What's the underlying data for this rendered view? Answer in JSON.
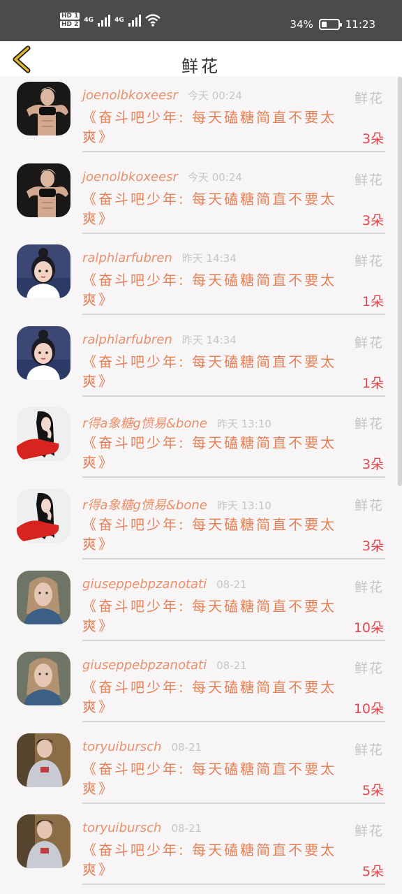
{
  "status_bar": {
    "hd1": "HD 1",
    "hd2": "HD 2",
    "net1": "4G",
    "net2": "4G",
    "battery_percent": 34,
    "battery_text": "34%",
    "time": "11:23"
  },
  "header": {
    "title": "鲜花",
    "back_icon": "chevron-left-icon",
    "accent_color": "#e1b52d"
  },
  "colors": {
    "username": "#e9906a",
    "message": "#e68157",
    "count": "#e0474d",
    "muted": "#c6c6c6"
  },
  "items": [
    {
      "username": "joenolbkoxeesr",
      "time": "今天 00:24",
      "tag": "鲜花",
      "message": "《奋斗吧少年: 每天磕糖简直不要太爽》",
      "count": "3朵",
      "avatar": "fitness-woman-avatar"
    },
    {
      "username": "joenolbkoxeesr",
      "time": "今天 00:24",
      "tag": "鲜花",
      "message": "《奋斗吧少年: 每天磕糖简直不要太爽》",
      "count": "3朵",
      "avatar": "fitness-woman-avatar"
    },
    {
      "username": "ralphlarfubren",
      "time": "昨天 14:34",
      "tag": "鲜花",
      "message": "《奋斗吧少年: 每天磕糖简直不要太爽》",
      "count": "1朵",
      "avatar": "cartoon-girl-avatar"
    },
    {
      "username": "ralphlarfubren",
      "time": "昨天 14:34",
      "tag": "鲜花",
      "message": "《奋斗吧少年: 每天磕糖简直不要太爽》",
      "count": "1朵",
      "avatar": "cartoon-girl-avatar"
    },
    {
      "username": "r得a象糖g愤易&bone",
      "time": "昨天 13:10",
      "tag": "鲜花",
      "message": "《奋斗吧少年: 每天磕糖简直不要太爽》",
      "count": "3朵",
      "avatar": "red-shirt-girl-avatar"
    },
    {
      "username": "r得a象糖g愤易&bone",
      "time": "昨天 13:10",
      "tag": "鲜花",
      "message": "《奋斗吧少年: 每天磕糖简直不要太爽》",
      "count": "3朵",
      "avatar": "red-shirt-girl-avatar"
    },
    {
      "username": "giuseppebpzanotati",
      "time": "08-21",
      "tag": "鲜花",
      "message": "《奋斗吧少年: 每天磕糖简直不要太爽》",
      "count": "10朵",
      "avatar": "blonde-girl-avatar"
    },
    {
      "username": "giuseppebpzanotati",
      "time": "08-21",
      "tag": "鲜花",
      "message": "《奋斗吧少年: 每天磕糖简直不要太爽》",
      "count": "10朵",
      "avatar": "blonde-girl-avatar"
    },
    {
      "username": "toryuibursch",
      "time": "08-21",
      "tag": "鲜花",
      "message": "《奋斗吧少年: 每天磕糖简直不要太爽》",
      "count": "5朵",
      "avatar": "young-man-avatar"
    },
    {
      "username": "toryuibursch",
      "time": "08-21",
      "tag": "鲜花",
      "message": "《奋斗吧少年: 每天磕糖简直不要太爽》",
      "count": "5朵",
      "avatar": "young-man-avatar"
    }
  ]
}
